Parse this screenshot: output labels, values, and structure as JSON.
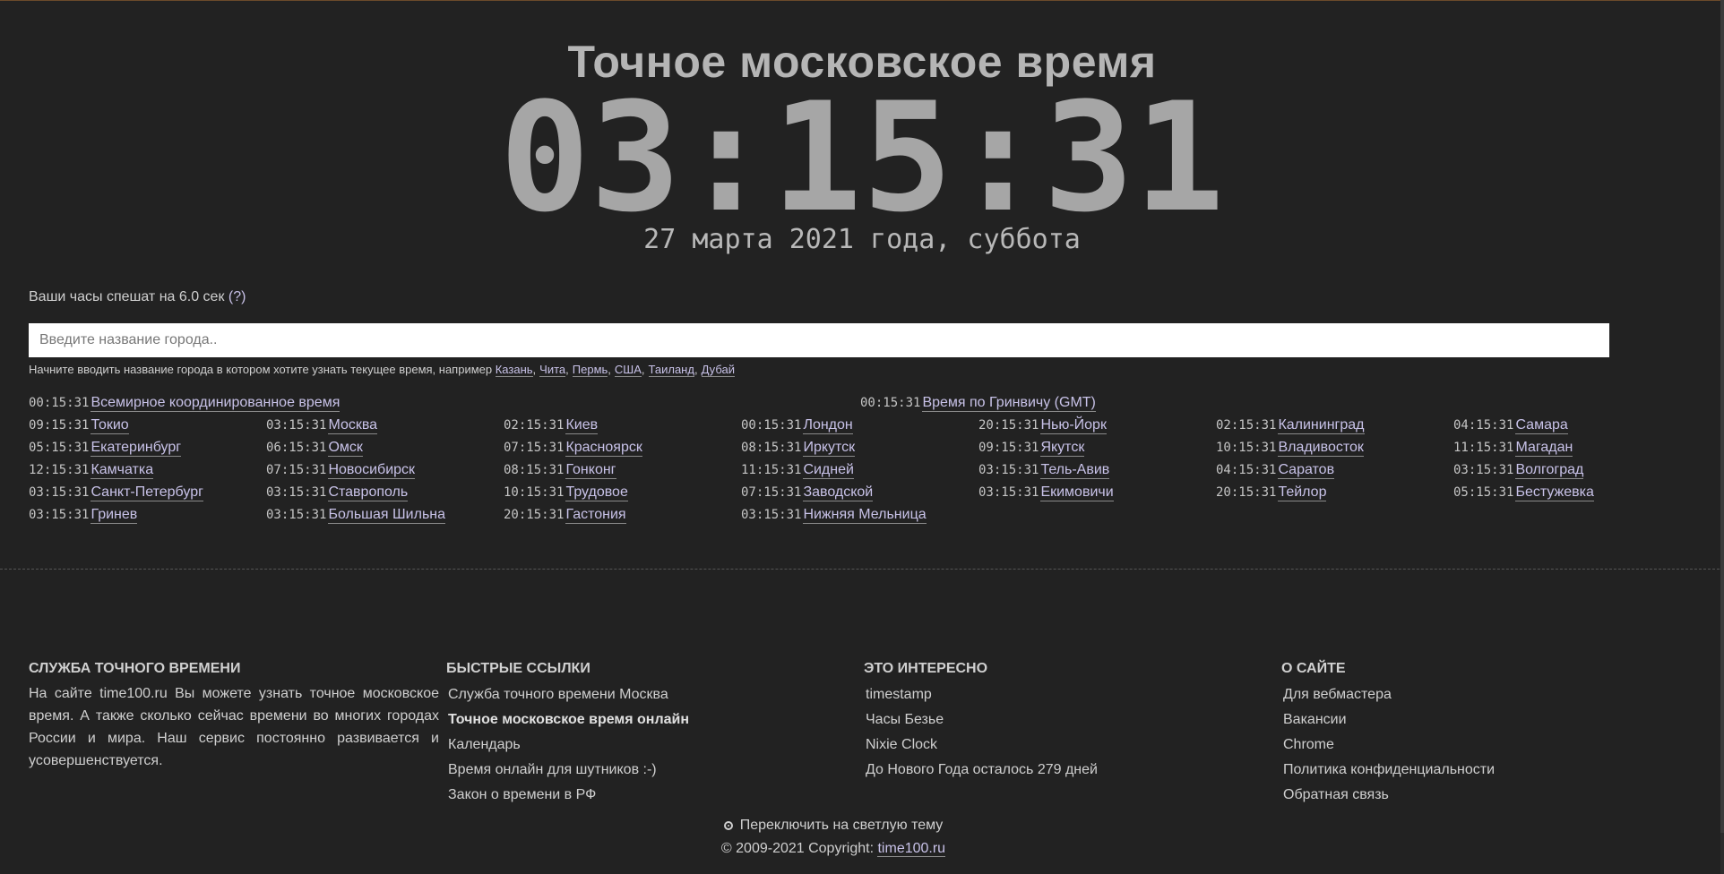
{
  "title": "Точное московское время",
  "clock": "03:15:31",
  "date": "27 марта 2021 года, суббота",
  "drift": {
    "text": "Ваши часы спешат на 6.0 сек",
    "help": "(?)"
  },
  "search": {
    "placeholder": "Введите название города..",
    "hint": "Начните вводить название города в котором хотите узнать текущее время, например",
    "examples": [
      "Казань",
      "Чита",
      "Пермь",
      "США",
      "Таиланд",
      "Дубай"
    ]
  },
  "top_row": [
    {
      "time": "00:15:31",
      "name": "Всемирное координированное время"
    },
    {
      "time": "00:15:31",
      "name": "Время по Гринвичу (GMT)"
    }
  ],
  "cities": [
    [
      {
        "time": "09:15:31",
        "name": "Токио"
      },
      {
        "time": "03:15:31",
        "name": "Москва"
      },
      {
        "time": "02:15:31",
        "name": "Киев"
      },
      {
        "time": "00:15:31",
        "name": "Лондон"
      },
      {
        "time": "20:15:31",
        "name": "Нью-Йорк"
      },
      {
        "time": "02:15:31",
        "name": "Калининград"
      },
      {
        "time": "04:15:31",
        "name": "Самара"
      }
    ],
    [
      {
        "time": "05:15:31",
        "name": "Екатеринбург"
      },
      {
        "time": "06:15:31",
        "name": "Омск"
      },
      {
        "time": "07:15:31",
        "name": "Красноярск"
      },
      {
        "time": "08:15:31",
        "name": "Иркутск"
      },
      {
        "time": "09:15:31",
        "name": "Якутск"
      },
      {
        "time": "10:15:31",
        "name": "Владивосток"
      },
      {
        "time": "11:15:31",
        "name": "Магадан"
      }
    ],
    [
      {
        "time": "12:15:31",
        "name": "Камчатка"
      },
      {
        "time": "07:15:31",
        "name": "Новосибирск"
      },
      {
        "time": "08:15:31",
        "name": "Гонконг"
      },
      {
        "time": "11:15:31",
        "name": "Сидней"
      },
      {
        "time": "03:15:31",
        "name": "Тель-Авив"
      },
      {
        "time": "04:15:31",
        "name": "Саратов"
      },
      {
        "time": "03:15:31",
        "name": "Волгоград"
      }
    ],
    [
      {
        "time": "03:15:31",
        "name": "Санкт-Петербург"
      },
      {
        "time": "03:15:31",
        "name": "Ставрополь"
      },
      {
        "time": "10:15:31",
        "name": "Трудовое"
      },
      {
        "time": "07:15:31",
        "name": "Заводской"
      },
      {
        "time": "03:15:31",
        "name": "Екимовичи"
      },
      {
        "time": "20:15:31",
        "name": "Тейлор"
      },
      {
        "time": "05:15:31",
        "name": "Бестужевка"
      }
    ],
    [
      {
        "time": "03:15:31",
        "name": "Гринев"
      },
      {
        "time": "03:15:31",
        "name": "Большая Шильна"
      },
      {
        "time": "20:15:31",
        "name": "Гастония"
      },
      {
        "time": "03:15:31",
        "name": "Нижняя Мельница"
      }
    ]
  ],
  "footer": {
    "about": {
      "heading": "СЛУЖБА ТОЧНОГО ВРЕМЕНИ",
      "text": "На сайте time100.ru Вы можете узнать точное московское время. А также сколько сейчас времени во многих городах России и мира. Наш сервис постоянно развивается и усовершенствуется."
    },
    "quick": {
      "heading": "БЫСТРЫЕ ССЫЛКИ",
      "links": [
        "Служба точного времени Москва",
        "Точное московское время онлайн",
        "Календарь",
        "Время онлайн для шутников :-)",
        "Закон о времени в РФ"
      ]
    },
    "interesting": {
      "heading": "ЭТО ИНТЕРЕСНО",
      "links": [
        "timestamp",
        "Часы Безье",
        "Nixie Clock",
        "До Нового Года осталось 279 дней"
      ]
    },
    "site": {
      "heading": "О САЙТЕ",
      "links": [
        "Для вебмастера",
        "Вакансии",
        "Chrome",
        "Политика конфиденциальности",
        "Обратная связь"
      ]
    },
    "theme_toggle": "Переключить на светлую тему",
    "copyright": "© 2009-2021 Copyright:",
    "copyright_link": "time100.ru"
  }
}
